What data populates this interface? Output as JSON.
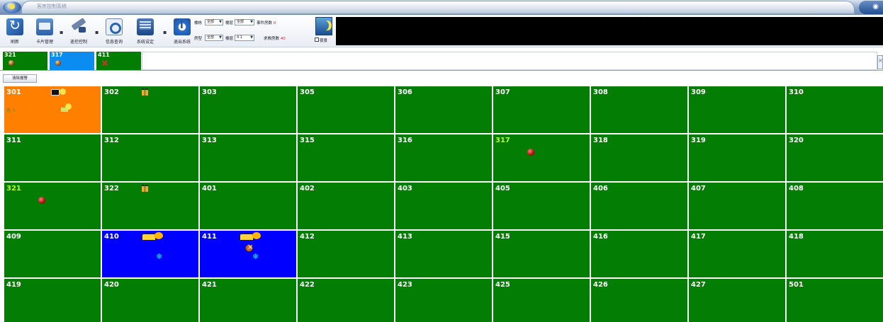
{
  "title_bar": {
    "title": "客房控制系统"
  },
  "toolbar": {
    "buttons": [
      {
        "id": "refresh",
        "label": "刷新"
      },
      {
        "id": "card",
        "label": "卡片管理"
      },
      {
        "id": "remote",
        "label": "遥控控制"
      },
      {
        "id": "query",
        "label": "信息查询"
      },
      {
        "id": "settings",
        "label": "系统设定"
      },
      {
        "id": "about",
        "label": "退出系统"
      }
    ],
    "filters": {
      "building_label": "楼栋",
      "building_value": "全部",
      "floor_label": "楼层",
      "floor_value": "全部",
      "room_type_label": "房型",
      "room_type_value": "全部",
      "status_label": "房态",
      "status_value": "全部",
      "events_label": "事件房数",
      "events_count": "0",
      "room_label": "楼层",
      "room_value": "4 1",
      "alarm_rooms_label": "求救房数",
      "alarm_rooms_count": "40"
    },
    "night_mode_label": "夜景"
  },
  "alert_strip": {
    "chips": [
      {
        "room": "321",
        "color": "#037d03",
        "icon": "alarm-bell-icon"
      },
      {
        "room": "317",
        "color": "#0a8cf0",
        "icon": "alarm-bell-icon"
      },
      {
        "room": "411",
        "color": "#037d03",
        "icon": "do-not-disturb-icon"
      }
    ]
  },
  "subbar": {
    "button_label": "清除报警"
  },
  "rooms": [
    {
      "number": "301",
      "status": "orange",
      "icons": [
        "card",
        "bulb",
        "key"
      ],
      "note": "客 人"
    },
    {
      "number": "302",
      "status": "green",
      "icons": [
        "person"
      ]
    },
    {
      "number": "303",
      "status": "green"
    },
    {
      "number": "305",
      "status": "green"
    },
    {
      "number": "306",
      "status": "green"
    },
    {
      "number": "307",
      "status": "green"
    },
    {
      "number": "308",
      "status": "green"
    },
    {
      "number": "309",
      "status": "green"
    },
    {
      "number": "310",
      "status": "green"
    },
    {
      "number": "311",
      "status": "green"
    },
    {
      "number": "312",
      "status": "green"
    },
    {
      "number": "313",
      "status": "green"
    },
    {
      "number": "315",
      "status": "green"
    },
    {
      "number": "316",
      "status": "green"
    },
    {
      "number": "317",
      "status": "green",
      "highlight": true,
      "icons": [
        "red"
      ]
    },
    {
      "number": "318",
      "status": "green"
    },
    {
      "number": "319",
      "status": "green"
    },
    {
      "number": "320",
      "status": "green"
    },
    {
      "number": "321",
      "status": "green",
      "highlight": true,
      "icons": [
        "red"
      ]
    },
    {
      "number": "322",
      "status": "green",
      "icons": [
        "person"
      ]
    },
    {
      "number": "401",
      "status": "green"
    },
    {
      "number": "402",
      "status": "green"
    },
    {
      "number": "403",
      "status": "green"
    },
    {
      "number": "405",
      "status": "green"
    },
    {
      "number": "406",
      "status": "green"
    },
    {
      "number": "407",
      "status": "green"
    },
    {
      "number": "408",
      "status": "green"
    },
    {
      "number": "409",
      "status": "green"
    },
    {
      "number": "410",
      "status": "blue",
      "icons": [
        "cleaning",
        "ac"
      ]
    },
    {
      "number": "411",
      "status": "blue",
      "icons": [
        "cleaning",
        "dnd",
        "ac"
      ]
    },
    {
      "number": "412",
      "status": "green"
    },
    {
      "number": "413",
      "status": "green"
    },
    {
      "number": "415",
      "status": "green"
    },
    {
      "number": "416",
      "status": "green"
    },
    {
      "number": "417",
      "status": "green"
    },
    {
      "number": "418",
      "status": "green"
    },
    {
      "number": "419",
      "status": "green"
    },
    {
      "number": "420",
      "status": "green"
    },
    {
      "number": "421",
      "status": "green"
    },
    {
      "number": "422",
      "status": "green"
    },
    {
      "number": "423",
      "status": "green"
    },
    {
      "number": "425",
      "status": "green"
    },
    {
      "number": "426",
      "status": "green"
    },
    {
      "number": "427",
      "status": "green"
    },
    {
      "number": "501",
      "status": "green"
    }
  ],
  "colors": {
    "vacant_green": "#047d04",
    "occupied_orange": "#ff8000",
    "service_blue": "#0000ff",
    "alert_text_yellow": "#b8ff2e"
  }
}
